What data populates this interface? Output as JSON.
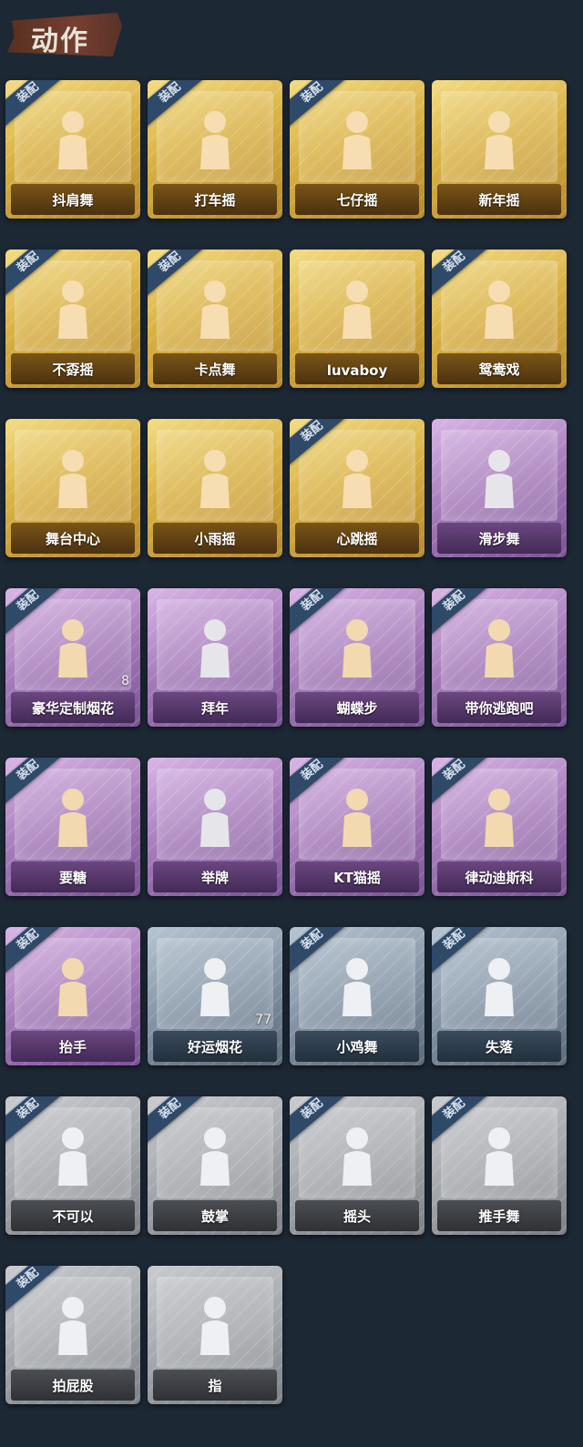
{
  "header": {
    "title": "动作"
  },
  "equip_badge": "装配",
  "cards": [
    {
      "label": "抖肩舞",
      "tier": "gold",
      "equipped": true,
      "icon": "figure-shoulder-shake-icon"
    },
    {
      "label": "打车摇",
      "tier": "gold",
      "equipped": true,
      "icon": "figure-taxi-shake-icon"
    },
    {
      "label": "七仔摇",
      "tier": "gold",
      "equipped": true,
      "icon": "figure-qizai-shake-icon"
    },
    {
      "label": "新年摇",
      "tier": "gold",
      "equipped": false,
      "icon": "figure-new-year-shake-icon"
    },
    {
      "label": "不孬摇",
      "tier": "gold",
      "equipped": true,
      "icon": "figure-point-up-icon"
    },
    {
      "label": "卡点舞",
      "tier": "gold",
      "equipped": true,
      "icon": "figure-beat-dance-icon"
    },
    {
      "label": "luvaboy",
      "tier": "gold",
      "equipped": false,
      "icon": "figure-luvaboy-icon"
    },
    {
      "label": "鸳鸯戏",
      "tier": "gold",
      "equipped": true,
      "icon": "figure-duet-icon"
    },
    {
      "label": "舞台中心",
      "tier": "gold",
      "equipped": false,
      "icon": "figure-center-stage-icon"
    },
    {
      "label": "小雨摇",
      "tier": "gold",
      "equipped": false,
      "icon": "figure-rain-shake-icon"
    },
    {
      "label": "心跳摇",
      "tier": "gold",
      "equipped": true,
      "icon": "figure-heartbeat-icon"
    },
    {
      "label": "滑步舞",
      "tier": "purple",
      "equipped": false,
      "icon": "figure-slide-step-icon"
    },
    {
      "label": "豪华定制烟花",
      "tier": "purple",
      "equipped": true,
      "icon": "fireworks-box-icon",
      "count": "8"
    },
    {
      "label": "拜年",
      "tier": "purple",
      "equipped": false,
      "icon": "figure-greeting-icon"
    },
    {
      "label": "蝴蝶步",
      "tier": "purple",
      "equipped": true,
      "icon": "figure-butterfly-step-icon"
    },
    {
      "label": "带你逃跑吧",
      "tier": "purple",
      "equipped": true,
      "icon": "figure-run-away-icon"
    },
    {
      "label": "要糖",
      "tier": "purple",
      "equipped": true,
      "icon": "figure-ask-candy-icon"
    },
    {
      "label": "举牌",
      "tier": "purple",
      "equipped": false,
      "icon": "figure-hold-sign-icon"
    },
    {
      "label": "KT猫摇",
      "tier": "purple",
      "equipped": true,
      "icon": "figure-kt-cat-icon"
    },
    {
      "label": "律动迪斯科",
      "tier": "purple",
      "equipped": true,
      "icon": "figure-disco-icon"
    },
    {
      "label": "抬手",
      "tier": "purple",
      "equipped": true,
      "icon": "figure-raise-hand-icon"
    },
    {
      "label": "好运烟花",
      "tier": "blue",
      "equipped": false,
      "icon": "firework-can-icon",
      "count": "77"
    },
    {
      "label": "小鸡舞",
      "tier": "blue",
      "equipped": true,
      "icon": "figure-chicken-dance-icon"
    },
    {
      "label": "失落",
      "tier": "blue",
      "equipped": true,
      "icon": "figure-crawl-icon"
    },
    {
      "label": "不可以",
      "tier": "gray",
      "equipped": true,
      "icon": "finger-wag-icon"
    },
    {
      "label": "鼓掌",
      "tier": "gray",
      "equipped": true,
      "icon": "clapping-hands-icon"
    },
    {
      "label": "摇头",
      "tier": "gray",
      "equipped": true,
      "icon": "figure-head-shake-icon"
    },
    {
      "label": "推手舞",
      "tier": "gray",
      "equipped": true,
      "icon": "figure-push-hands-icon"
    },
    {
      "label": "拍屁股",
      "tier": "gray",
      "equipped": true,
      "icon": "figure-pat-icon"
    },
    {
      "label": "指",
      "tier": "gray",
      "equipped": false,
      "icon": "pointing-hand-icon"
    }
  ]
}
